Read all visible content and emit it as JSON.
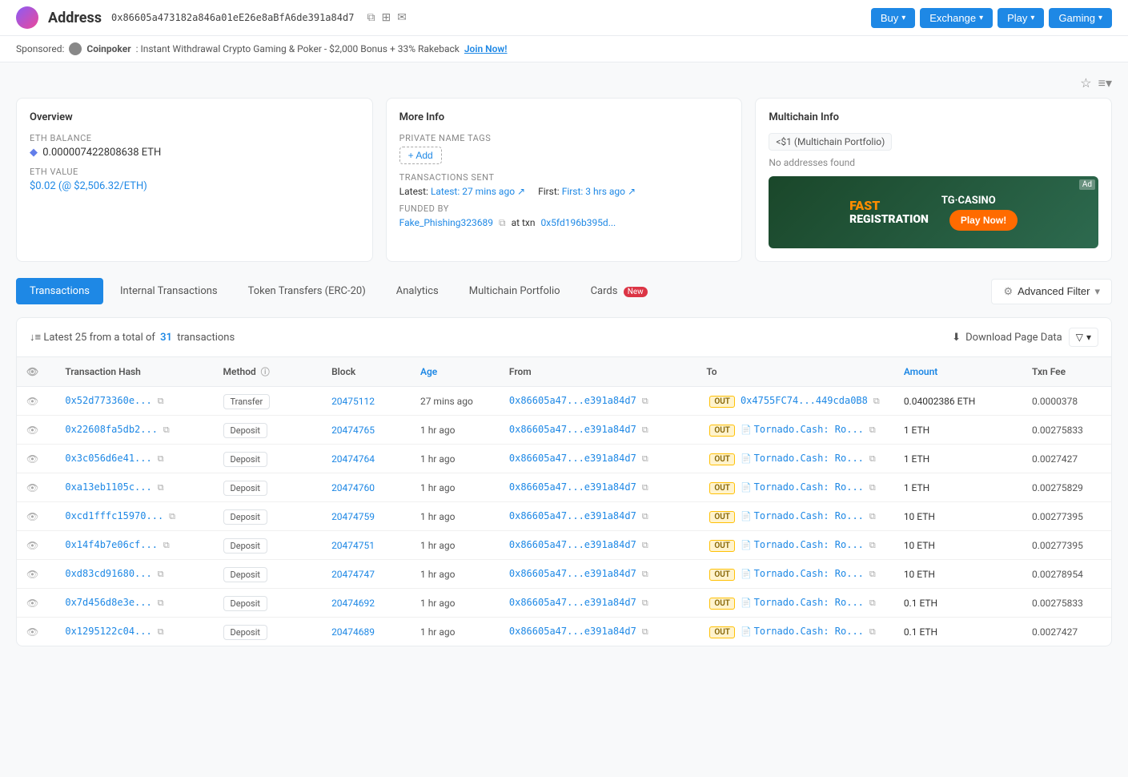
{
  "header": {
    "title": "Address",
    "address": "0x86605a473182a846a01eE26e8aBfA6de391a84d7",
    "buy_label": "Buy",
    "exchange_label": "Exchange",
    "play_label": "Play",
    "gaming_label": "Gaming"
  },
  "sponsored": {
    "label": "Sponsored:",
    "company": "Coinpoker",
    "text": ": Instant Withdrawal Crypto Gaming & Poker - $2,000 Bonus + 33% Rakeback",
    "join_label": "Join Now!"
  },
  "overview": {
    "title": "Overview",
    "eth_balance_label": "ETH BALANCE",
    "eth_balance_value": "0.000007422808638 ETH",
    "eth_value_label": "ETH VALUE",
    "eth_value": "$0.02 (@ $2,506.32/ETH)"
  },
  "more_info": {
    "title": "More Info",
    "private_name_tags_label": "PRIVATE NAME TAGS",
    "add_label": "+ Add",
    "transactions_sent_label": "TRANSACTIONS SENT",
    "latest_text": "Latest: 27 mins ago ↗",
    "first_text": "First: 3 hrs ago ↗",
    "funded_by_label": "FUNDED BY",
    "funded_address": "Fake_Phishing323689",
    "funded_at": "at txn",
    "funded_txn": "0x5fd196b395d..."
  },
  "multichain": {
    "title": "Multichain Info",
    "badge": "<$1 (Multichain Portfolio)",
    "no_addresses": "No addresses found",
    "ad_text": "FAST REGISTRATION",
    "ad_badge": "Ad",
    "play_btn": "Play Now!",
    "casino_name": "TG·CASINO"
  },
  "tabs": {
    "transactions": "Transactions",
    "internal_transactions": "Internal Transactions",
    "token_transfers": "Token Transfers (ERC-20)",
    "analytics": "Analytics",
    "multichain_portfolio": "Multichain Portfolio",
    "cards": "Cards",
    "cards_badge": "New",
    "advanced_filter": "Advanced Filter"
  },
  "transaction_table": {
    "summary_prefix": "Latest 25 from a total of",
    "total_count": "31",
    "summary_suffix": "transactions",
    "download_label": "Download Page Data",
    "columns": {
      "eye": "",
      "hash": "Transaction Hash",
      "method": "Method",
      "block": "Block",
      "age": "Age",
      "from": "From",
      "to": "To",
      "amount": "Amount",
      "fee": "Txn Fee"
    },
    "rows": [
      {
        "hash": "0x52d773360e...",
        "method": "Transfer",
        "block": "20475112",
        "age": "27 mins ago",
        "from": "0x86605a47...e391a84d7",
        "out": "OUT",
        "to": "0x4755FC74...449cda0B8",
        "to_icon": "",
        "amount": "0.04002386 ETH",
        "fee": "0.0000378"
      },
      {
        "hash": "0x22608fa5db2...",
        "method": "Deposit",
        "block": "20474765",
        "age": "1 hr ago",
        "from": "0x86605a47...e391a84d7",
        "out": "OUT",
        "to": "Tornado.Cash: Ro...",
        "to_icon": "tornado",
        "amount": "1 ETH",
        "fee": "0.00275833"
      },
      {
        "hash": "0x3c056d6e41...",
        "method": "Deposit",
        "block": "20474764",
        "age": "1 hr ago",
        "from": "0x86605a47...e391a84d7",
        "out": "OUT",
        "to": "Tornado.Cash: Ro...",
        "to_icon": "tornado",
        "amount": "1 ETH",
        "fee": "0.0027427"
      },
      {
        "hash": "0xa13eb1105c...",
        "method": "Deposit",
        "block": "20474760",
        "age": "1 hr ago",
        "from": "0x86605a47...e391a84d7",
        "out": "OUT",
        "to": "Tornado.Cash: Ro...",
        "to_icon": "tornado",
        "amount": "1 ETH",
        "fee": "0.00275829"
      },
      {
        "hash": "0xcd1fffc15970...",
        "method": "Deposit",
        "block": "20474759",
        "age": "1 hr ago",
        "from": "0x86605a47...e391a84d7",
        "out": "OUT",
        "to": "Tornado.Cash: Ro...",
        "to_icon": "tornado",
        "amount": "10 ETH",
        "fee": "0.00277395"
      },
      {
        "hash": "0x14f4b7e06cf...",
        "method": "Deposit",
        "block": "20474751",
        "age": "1 hr ago",
        "from": "0x86605a47...e391a84d7",
        "out": "OUT",
        "to": "Tornado.Cash: Ro...",
        "to_icon": "tornado",
        "amount": "10 ETH",
        "fee": "0.00277395"
      },
      {
        "hash": "0xd83cd91680...",
        "method": "Deposit",
        "block": "20474747",
        "age": "1 hr ago",
        "from": "0x86605a47...e391a84d7",
        "out": "OUT",
        "to": "Tornado.Cash: Ro...",
        "to_icon": "tornado",
        "amount": "10 ETH",
        "fee": "0.00278954"
      },
      {
        "hash": "0x7d456d8e3e...",
        "method": "Deposit",
        "block": "20474692",
        "age": "1 hr ago",
        "from": "0x86605a47...e391a84d7",
        "out": "OUT",
        "to": "Tornado.Cash: Ro...",
        "to_icon": "tornado",
        "amount": "0.1 ETH",
        "fee": "0.00275833"
      },
      {
        "hash": "0x1295122c04...",
        "method": "Deposit",
        "block": "20474689",
        "age": "1 hr ago",
        "from": "0x86605a47...e391a84d7",
        "out": "OUT",
        "to": "Tornado.Cash: Ro...",
        "to_icon": "tornado",
        "amount": "0.1 ETH",
        "fee": "0.0027427"
      }
    ]
  }
}
